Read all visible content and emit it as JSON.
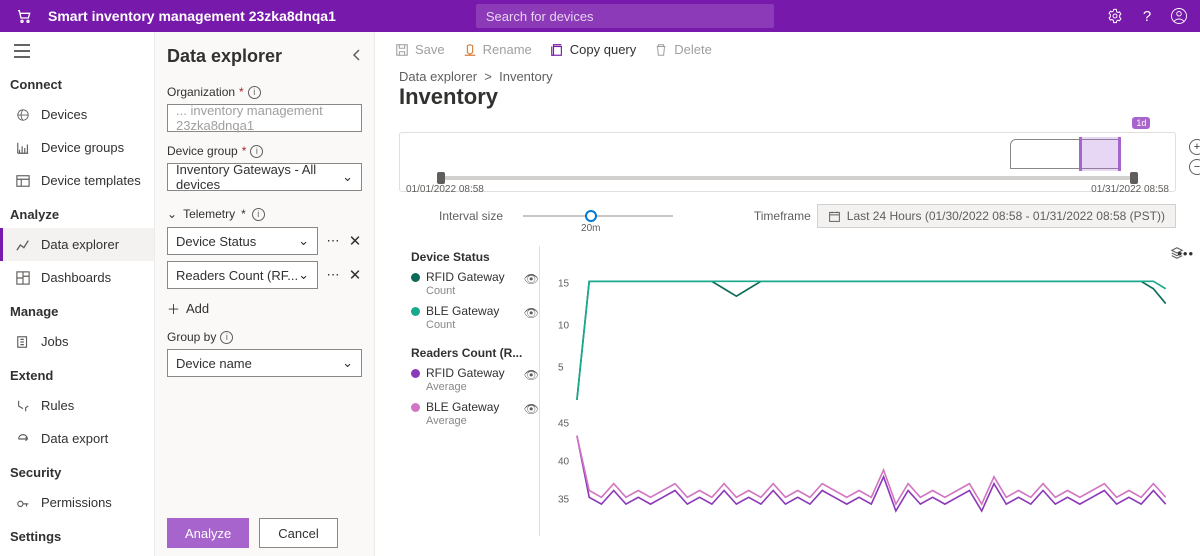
{
  "topbar": {
    "title": "Smart inventory management 23zka8dnqa1",
    "search_placeholder": "Search for devices"
  },
  "leftnav": {
    "sections": {
      "connect": "Connect",
      "analyze": "Analyze",
      "manage": "Manage",
      "extend": "Extend",
      "security": "Security",
      "settings": "Settings"
    },
    "items": {
      "devices": "Devices",
      "device_groups": "Device groups",
      "device_templates": "Device templates",
      "data_explorer": "Data explorer",
      "dashboards": "Dashboards",
      "jobs": "Jobs",
      "rules": "Rules",
      "data_export": "Data export",
      "permissions": "Permissions"
    }
  },
  "explorer": {
    "title": "Data explorer",
    "org_label": "Organization",
    "org_value": "... inventory management 23zka8dnqa1",
    "dg_label": "Device group",
    "dg_value": "Inventory Gateways - All devices",
    "tel_label": "Telemetry",
    "tel1": "Device Status",
    "tel2": "Readers Count (RF...",
    "add": "Add",
    "groupby_label": "Group by",
    "groupby_value": "Device name",
    "analyze": "Analyze",
    "cancel": "Cancel"
  },
  "toolbar": {
    "save": "Save",
    "rename": "Rename",
    "copy": "Copy query",
    "delete": "Delete"
  },
  "breadcrumb": {
    "root": "Data explorer",
    "leaf": "Inventory"
  },
  "page_title": "Inventory",
  "overview": {
    "start": "01/01/2022 08:58",
    "end": "01/31/2022 08:58",
    "badge": "1d"
  },
  "controls": {
    "interval_label": "Interval size",
    "interval_value": "20m",
    "timeframe_label": "Timeframe",
    "timeframe_value": "Last 24 Hours (01/30/2022 08:58 - 01/31/2022 08:58 (PST))"
  },
  "legend": {
    "g1": "Device Status",
    "g1a_name": "RFID Gateway",
    "g1a_sub": "Count",
    "g1a_color": "#0b6a58",
    "g1b_name": "BLE Gateway",
    "g1b_sub": "Count",
    "g1b_color": "#17a98c",
    "g2": "Readers Count (R...",
    "g2a_name": "RFID Gateway",
    "g2a_sub": "Average",
    "g2a_color": "#8d3ab9",
    "g2b_name": "BLE Gateway",
    "g2b_sub": "Average",
    "g2b_color": "#d176c2"
  },
  "chart_data": {
    "type": "line",
    "panels": [
      {
        "title": "Device Status",
        "ylabel": "Count",
        "ylim": [
          0,
          18
        ],
        "yticks": [
          5,
          10,
          15
        ],
        "x_range": [
          "01/30/2022 08:58",
          "01/31/2022 08:58"
        ],
        "series": [
          {
            "name": "RFID Gateway",
            "color": "#0b6a58",
            "values": [
              0,
              16,
              16,
              16,
              16,
              16,
              16,
              16,
              16,
              16,
              16,
              16,
              15,
              14,
              15,
              16,
              16,
              16,
              16,
              16,
              16,
              16,
              16,
              16,
              16,
              16,
              16,
              16,
              16,
              16,
              16,
              16,
              16,
              16,
              16,
              16,
              16,
              16,
              16,
              16,
              16,
              16,
              16,
              16,
              16,
              16,
              16,
              15,
              13
            ]
          },
          {
            "name": "BLE Gateway",
            "color": "#17a98c",
            "values": [
              0,
              16,
              16,
              16,
              16,
              16,
              16,
              16,
              16,
              16,
              16,
              16,
              16,
              16,
              16,
              16,
              16,
              16,
              16,
              16,
              16,
              16,
              16,
              16,
              16,
              16,
              16,
              16,
              16,
              16,
              16,
              16,
              16,
              16,
              16,
              16,
              16,
              16,
              16,
              16,
              16,
              16,
              16,
              16,
              16,
              16,
              16,
              16,
              15
            ]
          }
        ]
      },
      {
        "title": "Readers Count (R...)",
        "ylabel": "Average",
        "ylim": [
          30,
          48
        ],
        "yticks": [
          35,
          40,
          45
        ],
        "x_range": [
          "01/30/2022 08:58",
          "01/31/2022 08:58"
        ],
        "series": [
          {
            "name": "RFID Gateway",
            "color": "#8d3ab9",
            "values": [
              45,
              36,
              35,
              37,
              35,
              36,
              35,
              36,
              37,
              35,
              36,
              35,
              37,
              35,
              36,
              35,
              37,
              35,
              36,
              35,
              37,
              36,
              35,
              36,
              35,
              39,
              34,
              37,
              35,
              36,
              35,
              36,
              37,
              34,
              38,
              35,
              36,
              35,
              37,
              35,
              36,
              35,
              36,
              37,
              35,
              36,
              35,
              37,
              35
            ]
          },
          {
            "name": "BLE Gateway",
            "color": "#d176c2",
            "values": [
              45,
              37,
              36,
              38,
              36,
              37,
              36,
              37,
              38,
              36,
              37,
              36,
              38,
              36,
              37,
              36,
              38,
              36,
              37,
              36,
              38,
              37,
              36,
              37,
              36,
              40,
              35,
              38,
              36,
              37,
              36,
              37,
              38,
              35,
              39,
              36,
              37,
              36,
              38,
              36,
              37,
              36,
              37,
              38,
              36,
              37,
              36,
              38,
              36
            ]
          }
        ]
      }
    ]
  }
}
